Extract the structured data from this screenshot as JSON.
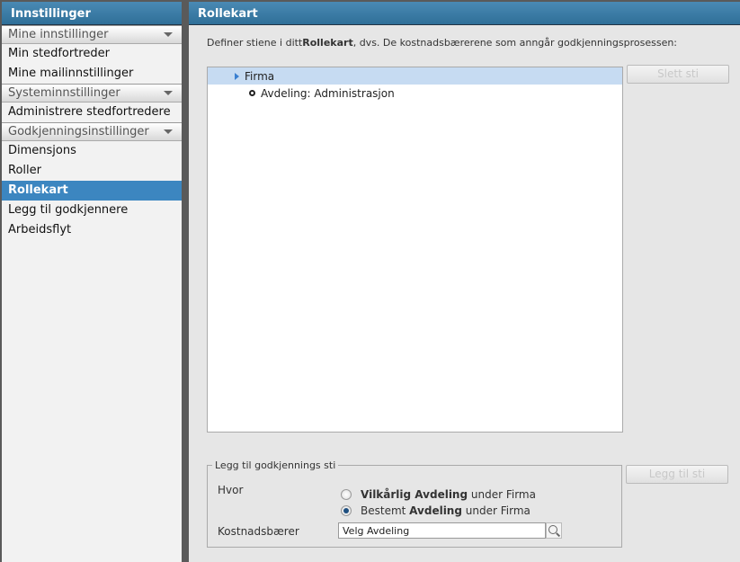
{
  "sidebar": {
    "title": "Innstillinger",
    "groups": [
      {
        "label": "Mine innstillinger",
        "items": [
          "Min stedfortreder",
          "Mine mailinnstillinger"
        ]
      },
      {
        "label": "Systeminnstillinger",
        "items": [
          "Administrere stedfortredere"
        ]
      },
      {
        "label": "Godkjenningsinstillinger",
        "items": [
          "Dimensjons",
          "Roller",
          "Rollekart",
          "Legg til godkjennere",
          "Arbeidsflyt"
        ]
      }
    ],
    "selected": "Rollekart"
  },
  "main": {
    "title": "Rollekart",
    "desc_pre": "Definer stiene i ditt",
    "desc_bold": "Rollekart",
    "desc_post": ", dvs. De kostnadsbærerene som anngår godkjenningsprosessen:",
    "tree": [
      "Firma",
      "Avdeling: Administrasjon"
    ],
    "delete_button": "Slett sti",
    "add_button": "Legg til sti",
    "form": {
      "legend": "Legg til godkjennings sti",
      "where_label": "Hvor",
      "opt1_bold": "Vilkårlig Avdeling",
      "opt1_rest": " under Firma",
      "opt2_pre": "Bestemt ",
      "opt2_bold": "Avdeling",
      "opt2_rest": " under Firma",
      "cost_label": "Kostnadsbærer",
      "cost_value": "Velg Avdeling"
    }
  }
}
